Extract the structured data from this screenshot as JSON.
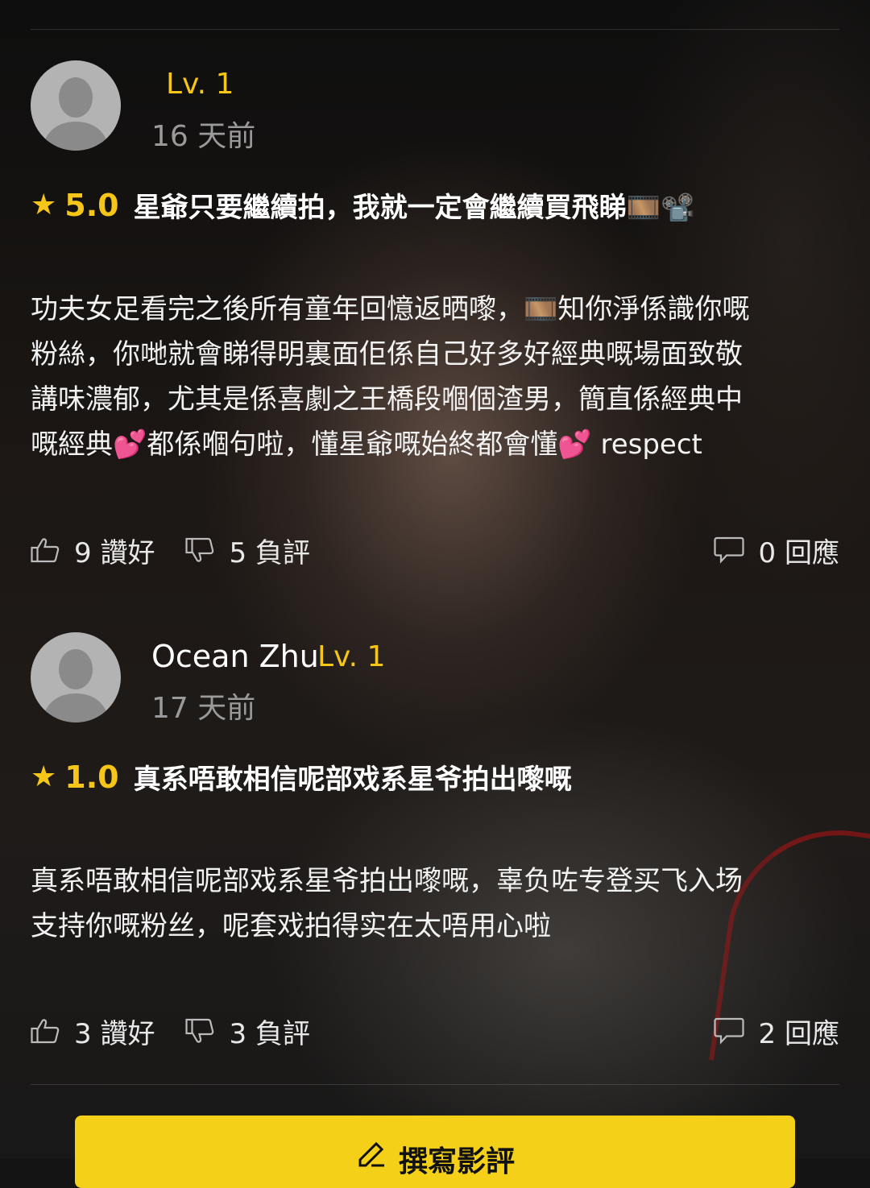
{
  "reviews": [
    {
      "user_name": "",
      "level": "Lv. 1",
      "time": "16 天前",
      "star": "★",
      "score": "5.0",
      "title": "星爺只要繼續拍，我就一定會繼續買飛睇🎞️📽️",
      "body": [
        "功夫女足看完之後所有童年回憶返晒嚟，🎞️知你淨係識你嘅",
        "粉絲，你哋就會睇得明裏面佢係自己好多好經典嘅場面致敬",
        "講味濃郁，尤其是係喜劇之王橋段嗰個渣男，簡直係經典中",
        "嘅經典💕都係嗰句啦，懂星爺嘅始終都會懂💕 respect"
      ],
      "likes": "9 讚好",
      "dislikes": "5 負評",
      "replies": "0 回應"
    },
    {
      "user_name": "Ocean Zhu",
      "level": "Lv. 1",
      "time": "17 天前",
      "star": "★",
      "score": "1.0",
      "title": "真系唔敢相信呢部戏系星爷拍出嚟嘅",
      "body": [
        "真系唔敢相信呢部戏系星爷拍出嚟嘅，辜负咗专登买飞入场",
        "支持你嘅粉丝，呢套戏拍得实在太唔用心啦"
      ],
      "likes": "3 讚好",
      "dislikes": "3 負評",
      "replies": "2 回應"
    }
  ],
  "write_review_label": "撰寫影評",
  "colors": {
    "accent": "#f5c518",
    "button": "#f5d019",
    "muted_text": "#9a9a9a"
  },
  "icons": {
    "avatar": "default-avatar-icon",
    "like": "thumbs-up-icon",
    "dislike": "thumbs-down-icon",
    "reply": "speech-bubble-icon",
    "write": "pencil-icon"
  }
}
